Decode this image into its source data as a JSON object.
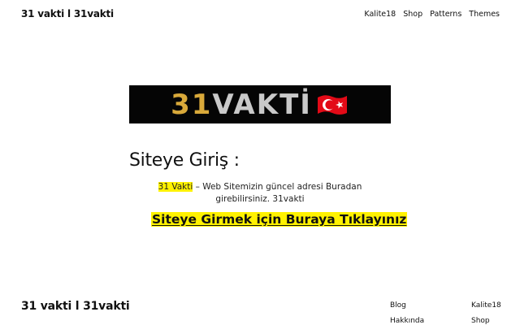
{
  "header": {
    "site_title": "31 vakti l 31vakti",
    "nav": [
      "Kalite18",
      "Shop",
      "Patterns",
      "Themes"
    ]
  },
  "logo": {
    "number": "31",
    "word": "VAKTİ",
    "colors": {
      "background": "#050505",
      "number": "#d9a93a",
      "word": "#c9c9c9",
      "flag": "#e30a17"
    }
  },
  "main": {
    "heading": "Siteye Giriş :",
    "highlight": "31 Vakti",
    "desc_rest": " – Web Sitemizin güncel adresi Buradan girebilirsiniz. 31vakti",
    "cta": "Siteye Girmek için Buraya Tıklayınız",
    "highlight_color": "#fff200"
  },
  "footer": {
    "title": "31 vakti l 31vakti",
    "col1": [
      "Blog",
      "Hakkında"
    ],
    "col2": [
      "Kalite18",
      "Shop"
    ]
  }
}
